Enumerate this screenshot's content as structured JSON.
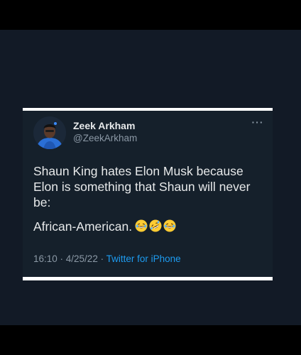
{
  "tweet": {
    "display_name": "Zeek Arkham",
    "handle": "@ZeekArkham",
    "paragraph1": "Shaun King hates Elon Musk because Elon is something that Shaun will never be:",
    "paragraph2": "African-American.",
    "emoji_icons": [
      "laughing-tears-emoji-icon",
      "rolling-laughing-emoji-icon",
      "laughing-tears-emoji-icon"
    ],
    "timestamp": "16:10 · 4/25/22 ·",
    "source": "Twitter for iPhone"
  },
  "colors": {
    "background": "#000000",
    "card": "#15202b",
    "text": "#e7e9ea",
    "muted": "#8b98a5",
    "link": "#1d9bf0"
  }
}
